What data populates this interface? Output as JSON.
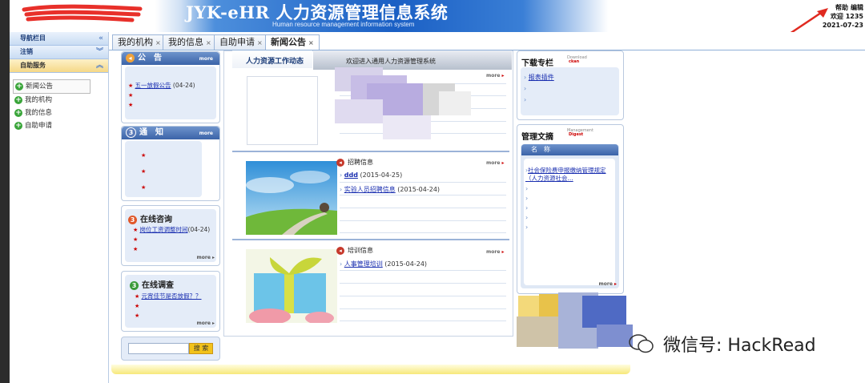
{
  "header": {
    "title": "JYK-eHR 人力资源管理信息系统",
    "subtitle": "Human resource management information system",
    "links": [
      "帮助",
      "编辑"
    ],
    "welcome": "欢迎 1235",
    "date": "2021-07-23"
  },
  "sidebar": {
    "nav_header": "导航栏目",
    "logout": "注销",
    "self_service": "自助服务",
    "items": [
      {
        "label": "新闻公告"
      },
      {
        "label": "我的机构"
      },
      {
        "label": "我的信息"
      },
      {
        "label": "自助申请"
      }
    ]
  },
  "tabs": [
    {
      "label": "我的机构",
      "close": "×"
    },
    {
      "label": "我的信息",
      "close": "×"
    },
    {
      "label": "自助申请",
      "close": "×"
    },
    {
      "label": "新闻公告",
      "close": "×"
    }
  ],
  "announce": {
    "title": "公　告",
    "more": "more",
    "items": [
      {
        "text": "五一放假公告",
        "date": "(04-24)"
      }
    ]
  },
  "notify": {
    "num": "3",
    "title": "通　知",
    "more": "more"
  },
  "consult": {
    "num": "3",
    "title": "在线咨询",
    "items": [
      {
        "text": "岗位工资调整时间",
        "date": "(04-24)"
      }
    ],
    "more": "more"
  },
  "survey": {
    "num": "3",
    "title": "在线调查",
    "items": [
      {
        "text": "元宵佳节是否放假？？"
      }
    ],
    "more": "more"
  },
  "search": {
    "button": "搜 索",
    "placeholder": ""
  },
  "center": {
    "work_title": "人力资源工作动态",
    "welcome": "欢迎进入通用人力资源管理系统",
    "more": "more",
    "recruit": {
      "title": "招聘信息",
      "more": "more",
      "items": [
        {
          "text": "ddd",
          "date": "(2015-04-25)"
        },
        {
          "text": "实验人员招聘信息",
          "date": "(2015-04-24)"
        }
      ]
    },
    "training": {
      "title": "培训信息",
      "more": "more",
      "items": [
        {
          "text": "人事管理培训",
          "date": "(2015-04-24)"
        }
      ]
    }
  },
  "download": {
    "title": "下载专栏",
    "tag": "Download",
    "tag2": "ckan",
    "items": [
      {
        "text": "报表插件"
      }
    ]
  },
  "digest": {
    "title": "管理文摘",
    "tag": "Management",
    "tag2": "Digest",
    "col": "名　称",
    "items": [
      {
        "text": "社会保险费申报缴纳管理规定（人力资源社会..."
      }
    ],
    "more": "more"
  },
  "watermark": "微信号: HackRead",
  "colors": {
    "header_blue": "#1a5fc4",
    "accent_red": "#cc0000",
    "gold": "#f2c21a"
  }
}
